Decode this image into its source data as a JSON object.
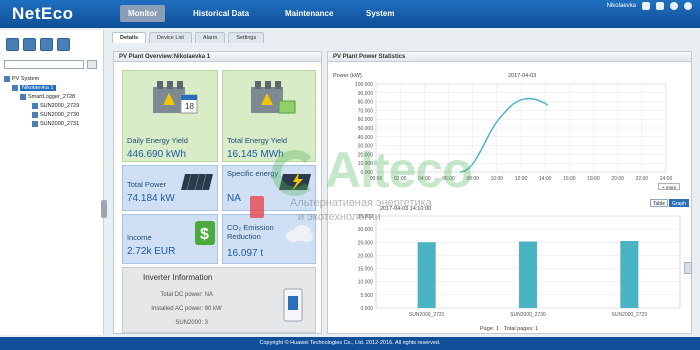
{
  "app": {
    "logo": "NetEco",
    "nav": [
      "Monitor",
      "Historical Data",
      "Maintenance",
      "System"
    ],
    "username": "Nikolaevka"
  },
  "tree": {
    "nodes": [
      {
        "label": "PV System",
        "level": 0
      },
      {
        "label": "Nikolaevka 1",
        "level": 1,
        "selected": true
      },
      {
        "label": "SmartLogger_2728",
        "level": 2
      },
      {
        "label": "SUN2000_2729",
        "level": 3
      },
      {
        "label": "SUN2000_2730",
        "level": 3
      },
      {
        "label": "SUN2000_2731",
        "level": 3
      }
    ]
  },
  "tabs": [
    "Details",
    "Device List",
    "Alarm",
    "Settings"
  ],
  "overview": {
    "title": "PV Plant Overview:Nikolaevka 1",
    "daily_yield_label": "Daily Energy Yield",
    "daily_yield_value": "446.690 kWh",
    "calendar_day": "18",
    "total_yield_label": "Total Energy Yield",
    "total_yield_value": "16.145 MWh",
    "total_power_label": "Total Power",
    "total_power_value": "74.184 kW",
    "specific_energy_label": "Specific energy",
    "specific_energy_value": "NA",
    "income_label": "Income",
    "income_value": "2.72k EUR",
    "co2_label": "CO₂ Emission Reduction",
    "co2_value": "16.097 t",
    "inverter_title": "Inverter Information",
    "inverter_rows": [
      {
        "label": "Total DC power:",
        "value": "NA"
      },
      {
        "label": "Installed AC power:",
        "value": "90 kW"
      },
      {
        "label": "SUN2000:",
        "value": "3"
      }
    ]
  },
  "power_stats": {
    "title": "PV Plant Power Statistics",
    "unit_label": "Power (kW)",
    "date": "2017-04-03",
    "more_button": "+ more"
  },
  "bar_panel": {
    "timestamp": "2017-04-03 14:10:00",
    "view_table": "Table",
    "view_graph": "Graph",
    "pager_page": "Page: 1",
    "pager_total": "Total pages: 1"
  },
  "chart_data": [
    {
      "type": "line",
      "title": "PV Plant Power Statistics",
      "ylabel": "Power (kW)",
      "date": "2017-04-03",
      "ylim": [
        0,
        100000
      ],
      "yticks": [
        "0.000",
        "10.000",
        "20.000",
        "30.000",
        "40.000",
        "50.000",
        "60.000",
        "70.000",
        "80.000",
        "90.000",
        "100.000"
      ],
      "xticks": [
        "00:00",
        "02:00",
        "04:00",
        "06:00",
        "08:00",
        "10:00",
        "12:00",
        "14:00",
        "16:00",
        "18:00",
        "20:00",
        "22:00",
        "24:00"
      ],
      "series": [
        {
          "x": [
            "07:00",
            "07:20",
            "07:40",
            "08:00",
            "08:20",
            "08:40",
            "09:00",
            "09:20",
            "09:40",
            "10:00",
            "10:20",
            "10:40",
            "11:00",
            "11:20",
            "11:40",
            "12:00",
            "12:20",
            "12:40",
            "13:00",
            "13:20",
            "13:40",
            "14:00",
            "14:10"
          ],
          "values": [
            0,
            1000,
            4000,
            9000,
            16000,
            24000,
            33000,
            42000,
            50000,
            57000,
            63000,
            68000,
            73000,
            77000,
            80000,
            82000,
            83000,
            83500,
            83000,
            82000,
            80000,
            78000,
            76000
          ]
        }
      ],
      "grid": true
    },
    {
      "type": "bar",
      "categories": [
        "SUN2000_2731",
        "SUN2000_2730",
        "SUN2000_2729"
      ],
      "values": [
        25000,
        25300,
        25500
      ],
      "ylim": [
        0,
        35000
      ],
      "yticks": [
        "0.000",
        "5.000",
        "10.000",
        "15.000",
        "20.000",
        "25.000",
        "30.000",
        "35.000"
      ],
      "color": "#4ab3c4",
      "grid": true
    }
  ],
  "watermark": {
    "text": "Alteco",
    "subtitle_line1": "Альтернативная энергетика",
    "subtitle_line2": "и экотехнологии"
  },
  "footer": {
    "copyright": "Copyright © Huawei Technologies Co., Ltd. 2012-2016. All rights reserved."
  }
}
